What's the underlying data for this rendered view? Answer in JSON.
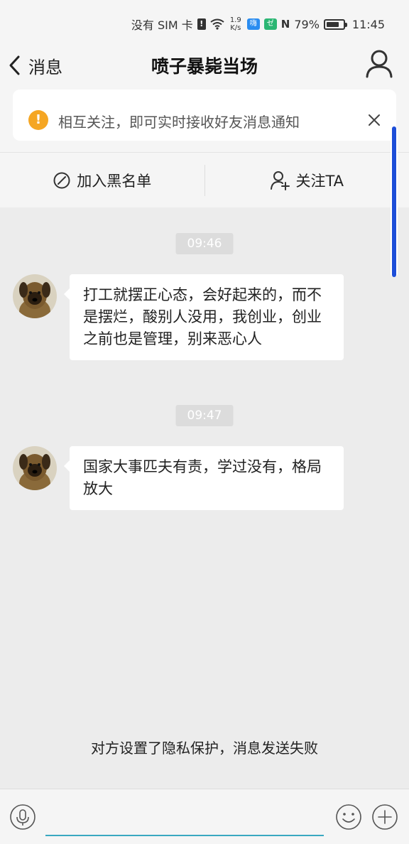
{
  "status_bar": {
    "sim_text": "没有 SIM 卡",
    "sim_alert": "!",
    "net_speed_value": "1.9",
    "net_speed_unit": "K/s",
    "app_badge_1": "嗨",
    "app_badge_2": "ゼ",
    "nfc_icon": "N",
    "battery_level": "79%",
    "battery_fraction": 0.79,
    "time": "11:45"
  },
  "header": {
    "back_label": "消息",
    "title": "喷子暴毙当场"
  },
  "notice": {
    "text": "相互关注，即可实时接收好友消息通知",
    "icon_glyph": "!",
    "accent": "#f5a623"
  },
  "actions": {
    "block_label": "加入黑名单",
    "follow_label": "关注TA"
  },
  "chat": {
    "messages": [
      {
        "time": "09:46",
        "text": "打工就摆正心态，会好起来的，而不是摆烂，酸别人没用，我创业，创业之前也是管理，别来恶心人"
      },
      {
        "time": "09:47",
        "text": "国家大事匹夫有责，学过没有，格局放大"
      }
    ]
  },
  "toast": {
    "text": "对方设置了隐私保护，消息发送失败"
  },
  "input_bar": {
    "placeholder": ""
  },
  "colors": {
    "scrollbar": "#1d4ed8",
    "input_underline": "#3aa8c1"
  }
}
